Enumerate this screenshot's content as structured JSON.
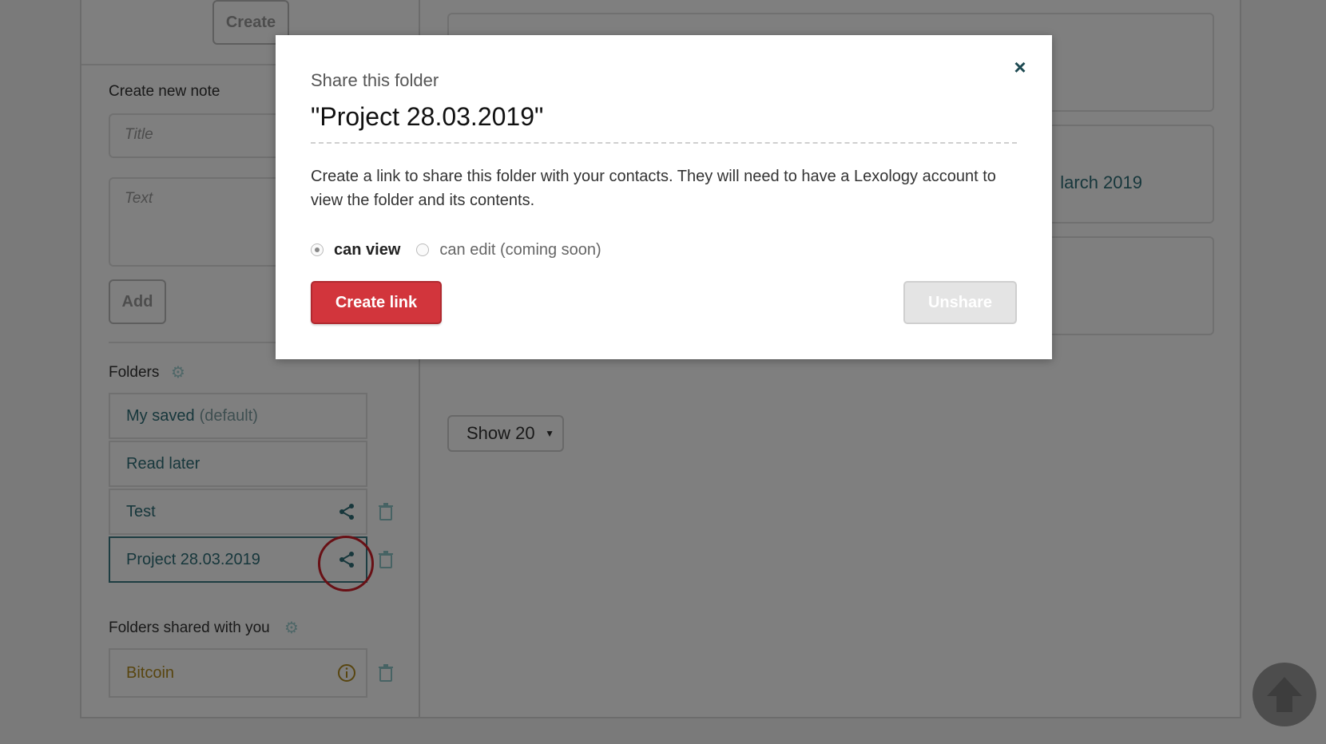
{
  "sidebar": {
    "create_button": "Create",
    "new_note_label": "Create new note",
    "title_placeholder": "Title",
    "text_placeholder": "Text",
    "add_button": "Add",
    "folders_label": "Folders",
    "folders": [
      {
        "name": "My saved",
        "suffix": "(default)"
      },
      {
        "name": "Read later"
      },
      {
        "name": "Test"
      },
      {
        "name": "Project 28.03.2019"
      }
    ],
    "shared_label": "Folders shared with you",
    "shared_folders": [
      {
        "name": "Bitcoin"
      }
    ]
  },
  "main": {
    "card_partial_text": "larch 2019",
    "show_select": "Show 20"
  },
  "modal": {
    "subtitle": "Share this folder",
    "title": "\"Project 28.03.2019\"",
    "description": "Create a link to share this folder with your contacts. They will need to have a Lexology account to view the folder and its contents.",
    "options": [
      {
        "label": "can view",
        "selected": true
      },
      {
        "label": "can edit (coming soon)",
        "selected": false
      }
    ],
    "create_link_button": "Create link",
    "unshare_button": "Unshare",
    "close_symbol": "×"
  },
  "colors": {
    "primary_red": "#d2353c",
    "teal_text": "#2f6f78",
    "highlight_circle": "#d0202a"
  }
}
